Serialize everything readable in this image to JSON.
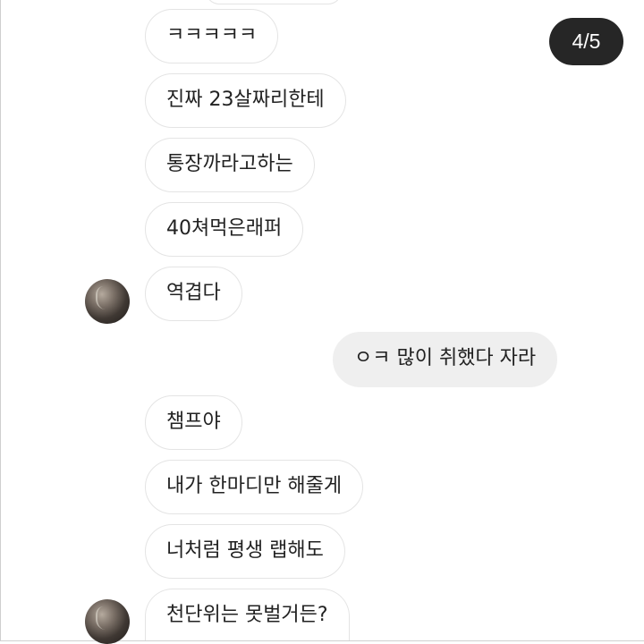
{
  "viewer": {
    "page_indicator": "4/5"
  },
  "chat": {
    "messages": [
      {
        "text": "ㅋㅋㅋㅋㅋ",
        "from": "other"
      },
      {
        "text": "진짜 23살짜리한테",
        "from": "other"
      },
      {
        "text": "통장까라고하는",
        "from": "other"
      },
      {
        "text": "40쳐먹은래퍼",
        "from": "other"
      },
      {
        "text": "역겹다",
        "from": "other"
      },
      {
        "text": "ㅇㅋ 많이 취했다 자라",
        "from": "me"
      },
      {
        "text": "챔프야",
        "from": "other"
      },
      {
        "text": "내가 한마디만 해줄게",
        "from": "other"
      },
      {
        "text": "너처럼 평생 랩해도",
        "from": "other"
      },
      {
        "text": "천단위는 못벌거든?",
        "from": "other"
      }
    ]
  }
}
